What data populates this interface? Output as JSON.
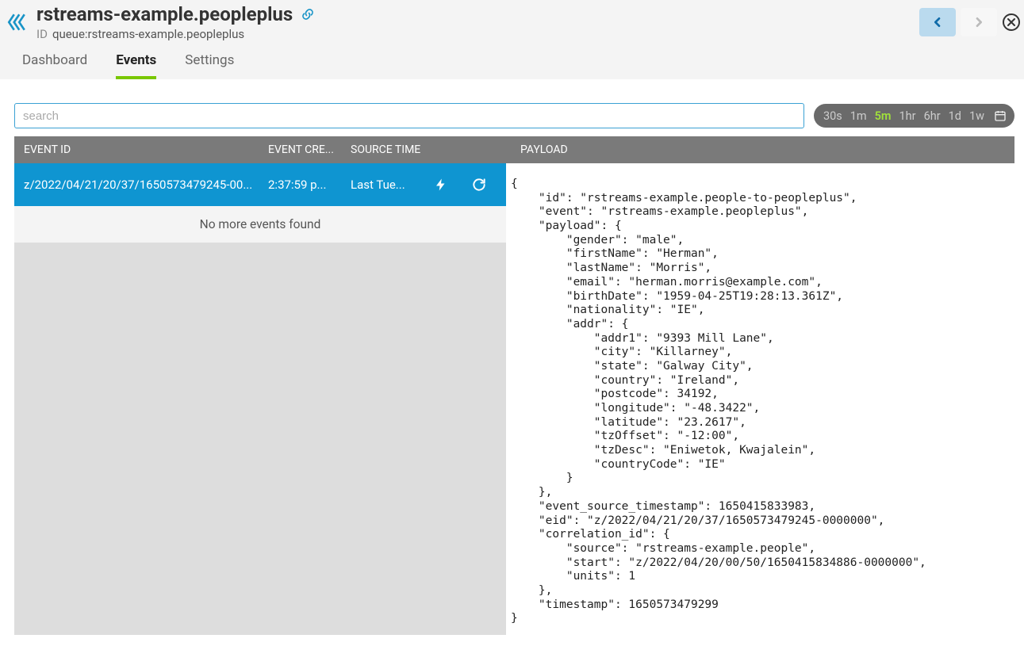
{
  "header": {
    "title": "rstreams-example.peopleplus",
    "id_label": "ID",
    "id_value": "queue:rstreams-example.peopleplus"
  },
  "tabs": [
    {
      "label": "Dashboard",
      "active": false
    },
    {
      "label": "Events",
      "active": true
    },
    {
      "label": "Settings",
      "active": false
    }
  ],
  "search": {
    "placeholder": "search",
    "value": ""
  },
  "time_ranges": [
    "30s",
    "1m",
    "5m",
    "1hr",
    "6hr",
    "1d",
    "1w"
  ],
  "time_active": "5m",
  "columns": {
    "event_id": "EVENT ID",
    "created": "EVENT CRE...",
    "source": "SOURCE TIME",
    "payload": "PAYLOAD"
  },
  "event_row": {
    "id": "z/2022/04/21/20/37/1650573479245-00...",
    "created": "2:37:59 p...",
    "source": "Last Tue..."
  },
  "no_more": "No more events found",
  "payload_text": "{\n    \"id\": \"rstreams-example.people-to-peopleplus\",\n    \"event\": \"rstreams-example.peopleplus\",\n    \"payload\": {\n        \"gender\": \"male\",\n        \"firstName\": \"Herman\",\n        \"lastName\": \"Morris\",\n        \"email\": \"herman.morris@example.com\",\n        \"birthDate\": \"1959-04-25T19:28:13.361Z\",\n        \"nationality\": \"IE\",\n        \"addr\": {\n            \"addr1\": \"9393 Mill Lane\",\n            \"city\": \"Killarney\",\n            \"state\": \"Galway City\",\n            \"country\": \"Ireland\",\n            \"postcode\": 34192,\n            \"longitude\": \"-48.3422\",\n            \"latitude\": \"23.2617\",\n            \"tzOffset\": \"-12:00\",\n            \"tzDesc\": \"Eniwetok, Kwajalein\",\n            \"countryCode\": \"IE\"\n        }\n    },\n    \"event_source_timestamp\": 1650415833983,\n    \"eid\": \"z/2022/04/21/20/37/1650573479245-0000000\",\n    \"correlation_id\": {\n        \"source\": \"rstreams-example.people\",\n        \"start\": \"z/2022/04/20/00/50/1650415834886-0000000\",\n        \"units\": 1\n    },\n    \"timestamp\": 1650573479299\n}"
}
